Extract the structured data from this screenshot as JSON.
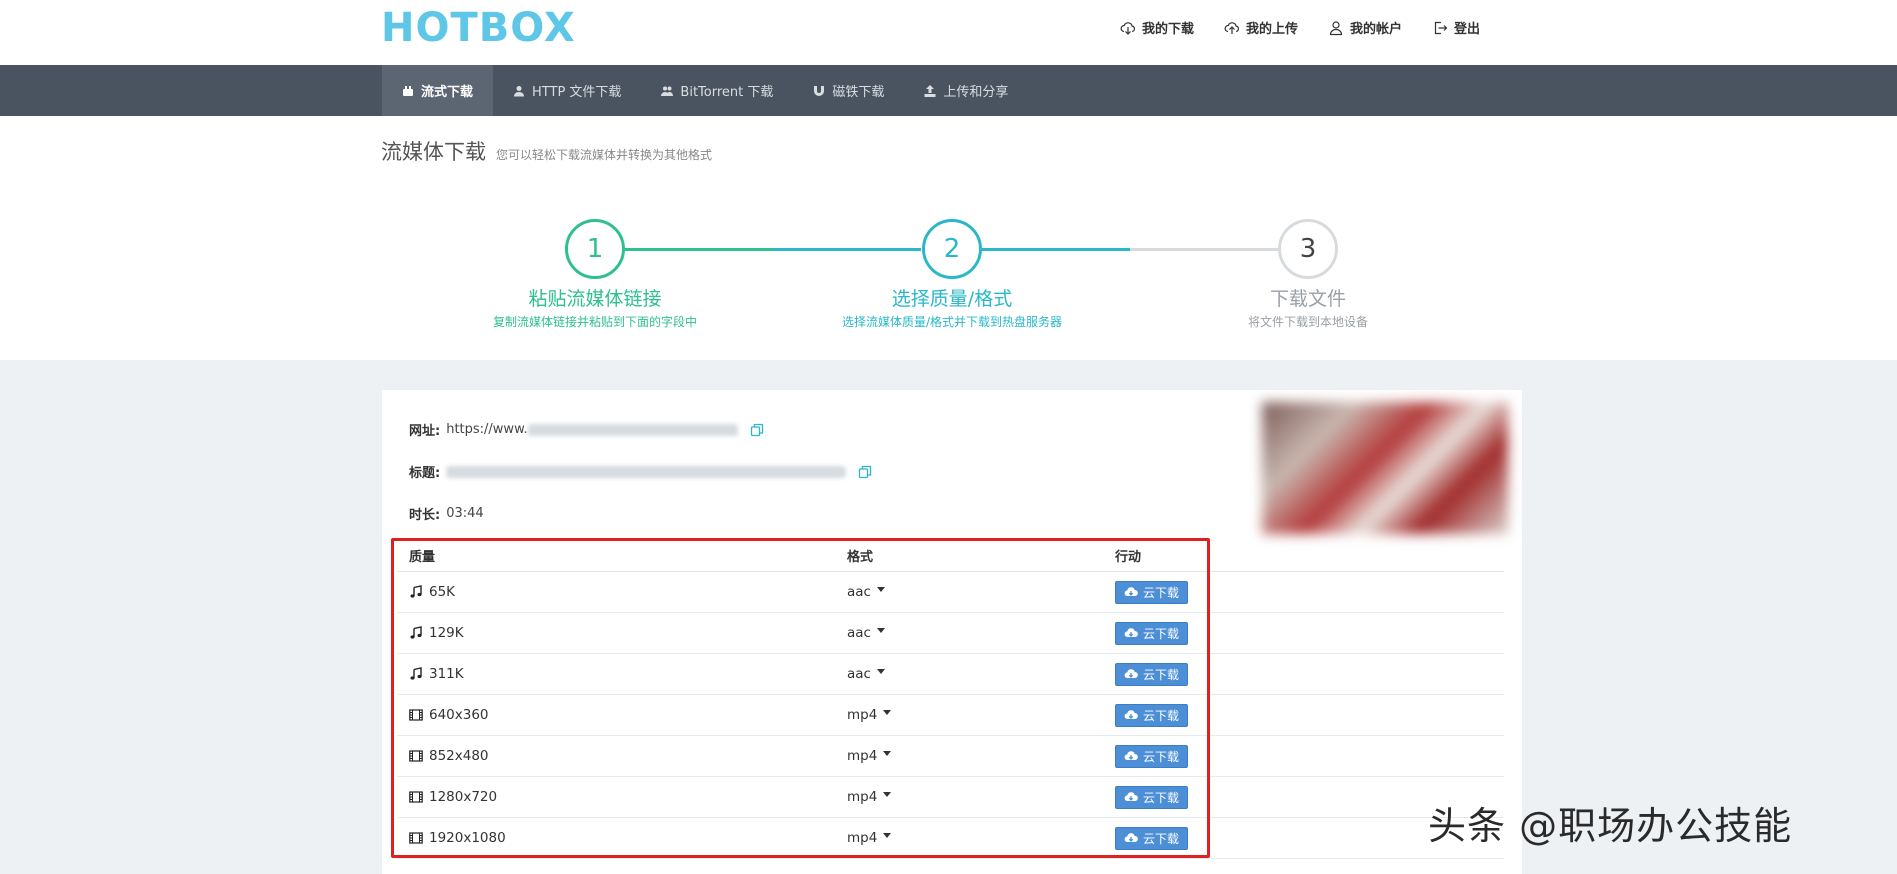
{
  "header": {
    "logo": "HOTBOX",
    "nav": [
      {
        "label": "我的下载",
        "icon": "cloud-download-icon"
      },
      {
        "label": "我的上传",
        "icon": "cloud-upload-icon"
      },
      {
        "label": "我的帐户",
        "icon": "user-icon"
      },
      {
        "label": "登出",
        "icon": "logout-icon"
      }
    ]
  },
  "tabs": [
    {
      "label": "流式下载",
      "icon": "stream-icon",
      "active": true
    },
    {
      "label": "HTTP 文件下载",
      "icon": "user-icon",
      "active": false
    },
    {
      "label": "BitTorrent 下载",
      "icon": "users-icon",
      "active": false
    },
    {
      "label": "磁铁下载",
      "icon": "magnet-icon",
      "active": false
    },
    {
      "label": "上传和分享",
      "icon": "upload-icon",
      "active": false
    }
  ],
  "page": {
    "title": "流媒体下载",
    "subtitle": "您可以轻松下载流媒体并转换为其他格式"
  },
  "steps": [
    {
      "num": "1",
      "title": "粘贴流媒体链接",
      "sub": "复制流媒体链接并粘贴到下面的字段中",
      "color": "#2fc08f"
    },
    {
      "num": "2",
      "title": "选择质量/格式",
      "sub": "选择流媒体质量/格式并下载到热盘服务器",
      "color": "#2ab8c8"
    },
    {
      "num": "3",
      "title": "下载文件",
      "sub": "将文件下载到本地设备",
      "color": "#9aa0a6"
    }
  ],
  "media": {
    "url_label": "网址:",
    "url_value": "https://www.",
    "title_label": "标题:",
    "duration_label": "时长:",
    "duration_value": "03:44"
  },
  "table": {
    "headers": [
      "质量",
      "格式",
      "行动"
    ],
    "action_label": "云下载",
    "rows": [
      {
        "icon": "music-icon",
        "quality": "65K",
        "format": "aac"
      },
      {
        "icon": "music-icon",
        "quality": "129K",
        "format": "aac"
      },
      {
        "icon": "music-icon",
        "quality": "311K",
        "format": "aac"
      },
      {
        "icon": "film-icon",
        "quality": "640x360",
        "format": "mp4"
      },
      {
        "icon": "film-icon",
        "quality": "852x480",
        "format": "mp4"
      },
      {
        "icon": "film-icon",
        "quality": "1280x720",
        "format": "mp4"
      },
      {
        "icon": "film-icon",
        "quality": "1920x1080",
        "format": "mp4"
      }
    ]
  },
  "watermark": "头条 @职场办公技能",
  "colors": {
    "accent": "#5ec6e6",
    "navbar": "#4a5460",
    "button": "#4d8fd6",
    "highlight": "#e02020"
  }
}
